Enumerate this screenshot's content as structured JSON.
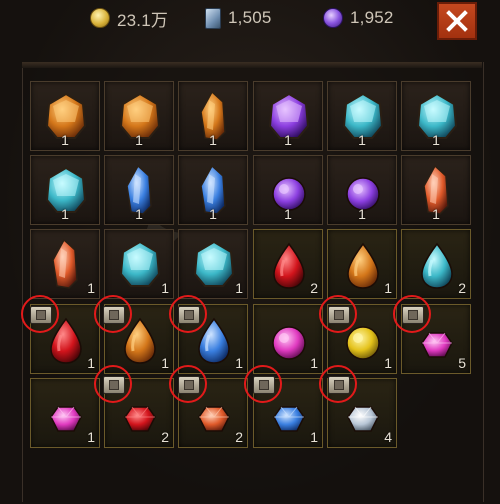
{
  "currencies": [
    {
      "name": "gold",
      "icon": "gold-coin-icon",
      "value": "23.1万"
    },
    {
      "name": "cards",
      "icon": "card-icon",
      "value": "1,505"
    },
    {
      "name": "orbs",
      "icon": "purple-orb-icon",
      "value": "1,952"
    }
  ],
  "close_label": "✕",
  "colors": {
    "accent_red": "#e21a1a",
    "close_bg": "#b53c16"
  },
  "grid": {
    "rows": [
      [
        {
          "item": "amber-gem-cluster-icon",
          "count": "1"
        },
        {
          "item": "amber-gem-cluster-icon",
          "count": "1"
        },
        {
          "item": "amber-crystal-shard-icon",
          "count": "1"
        },
        {
          "item": "purple-crystal-cluster-icon",
          "count": "1"
        },
        {
          "item": "teal-gem-cluster-icon",
          "count": "1"
        },
        {
          "item": "teal-gem-cluster-icon",
          "count": "1"
        }
      ],
      [
        {
          "item": "teal-gem-cluster-icon",
          "count": "1"
        },
        {
          "item": "blue-crystal-icon",
          "count": "1"
        },
        {
          "item": "blue-crystal-icon",
          "count": "1"
        },
        {
          "item": "purple-orb-gem-icon",
          "count": "1"
        },
        {
          "item": "purple-orb-gem-icon",
          "count": "1"
        },
        {
          "item": "orange-crystal-icon",
          "count": "1"
        }
      ],
      [
        {
          "item": "orange-crystal-icon",
          "count": "1"
        },
        {
          "item": "teal-crystal-cluster-icon",
          "count": "1"
        },
        {
          "item": "teal-crystal-cluster-icon",
          "count": "1"
        },
        {
          "item": "red-drop-gem-icon",
          "count": "2"
        },
        {
          "item": "amber-drop-gem-icon",
          "count": "1"
        },
        {
          "item": "teal-drop-gem-icon",
          "count": "2"
        }
      ],
      [
        {
          "item": "red-drop-gem-icon",
          "count": "1"
        },
        {
          "item": "amber-drop-gem-icon",
          "count": "1"
        },
        {
          "item": "blue-drop-gem-icon",
          "count": "1"
        },
        {
          "item": "pink-round-gem-icon",
          "count": "1"
        },
        {
          "item": "yellow-round-gem-icon",
          "count": "1"
        },
        {
          "item": "pink-faceted-gem-icon",
          "count": "5"
        }
      ],
      [
        {
          "item": "pink-faceted-gem-icon",
          "count": "1"
        },
        {
          "item": "red-faceted-gem-icon",
          "count": "2"
        },
        {
          "item": "orange-faceted-gem-icon",
          "count": "2"
        },
        {
          "item": "blue-faceted-gem-icon",
          "count": "1"
        },
        {
          "item": "white-faceted-gem-icon",
          "count": "4"
        }
      ]
    ]
  }
}
